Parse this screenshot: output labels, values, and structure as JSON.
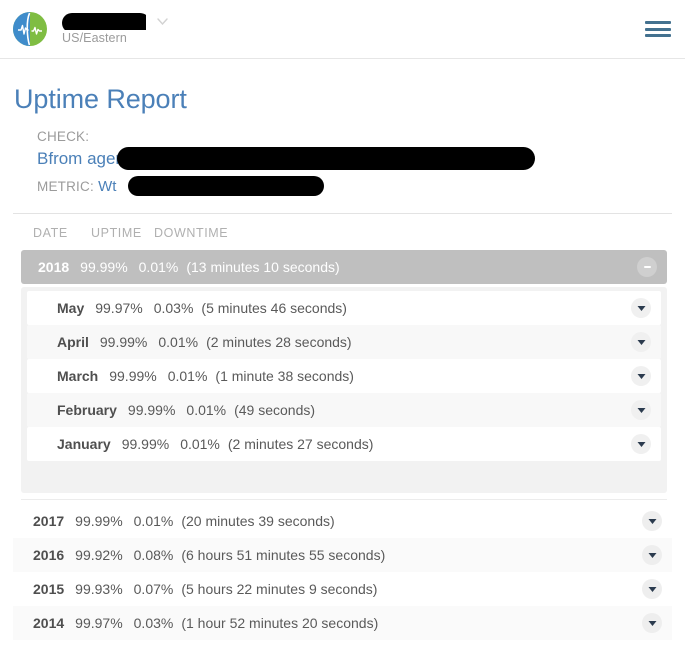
{
  "navbar": {
    "logo_icon": "pulse-globe-logo",
    "org_name_redacted": true,
    "timezone": "US/Eastern",
    "dropdown_icon": "chevron-down-icon",
    "menu_icon": "hamburger-menu-icon"
  },
  "page": {
    "title": "Uptime Report",
    "check_label": "CHECK:",
    "check_prefix": "B",
    "check_suffix": "from agent-1)",
    "metric_label": "METRIC:",
    "metric_prefix": "W",
    "metric_suffix": "t"
  },
  "table": {
    "headers": {
      "date": "DATE",
      "uptime": "UPTIME",
      "downtime": "DOWNTIME"
    },
    "selected_row": {
      "date": "2018",
      "uptime": "99.99%",
      "downtime": "0.01%",
      "duration": "(13 minutes 10 seconds)",
      "toggle_icon": "collapse-icon"
    },
    "months": [
      {
        "date": "May",
        "uptime": "99.97%",
        "downtime": "0.03%",
        "duration": "(5 minutes 46 seconds)",
        "toggle_icon": "chevron-down-icon"
      },
      {
        "date": "April",
        "uptime": "99.99%",
        "downtime": "0.01%",
        "duration": "(2 minutes 28 seconds)",
        "toggle_icon": "chevron-down-icon"
      },
      {
        "date": "March",
        "uptime": "99.99%",
        "downtime": "0.01%",
        "duration": "(1 minute 38 seconds)",
        "toggle_icon": "chevron-down-icon"
      },
      {
        "date": "February",
        "uptime": "99.99%",
        "downtime": "0.01%",
        "duration": "(49 seconds)",
        "toggle_icon": "chevron-down-icon"
      },
      {
        "date": "January",
        "uptime": "99.99%",
        "downtime": "0.01%",
        "duration": "(2 minutes 27 seconds)",
        "toggle_icon": "chevron-down-icon"
      }
    ],
    "years": [
      {
        "date": "2017",
        "uptime": "99.99%",
        "downtime": "0.01%",
        "duration": "(20 minutes 39 seconds)",
        "toggle_icon": "chevron-down-icon"
      },
      {
        "date": "2016",
        "uptime": "99.92%",
        "downtime": "0.08%",
        "duration": "(6 hours 51 minutes 55 seconds)",
        "toggle_icon": "chevron-down-icon"
      },
      {
        "date": "2015",
        "uptime": "99.93%",
        "downtime": "0.07%",
        "duration": "(5 hours 22 minutes 9 seconds)",
        "toggle_icon": "chevron-down-icon"
      },
      {
        "date": "2014",
        "uptime": "99.97%",
        "downtime": "0.03%",
        "duration": "(1 hour 52 minutes 20 seconds)",
        "toggle_icon": "chevron-down-icon"
      }
    ]
  },
  "colors": {
    "title_blue": "#4b80b8",
    "link_blue": "#4b80b8",
    "selected_row_bg": "#bfbfbf",
    "logo_blue": "#3f8ccb",
    "logo_green": "#7fbd42",
    "menu_blue": "#43718f"
  }
}
